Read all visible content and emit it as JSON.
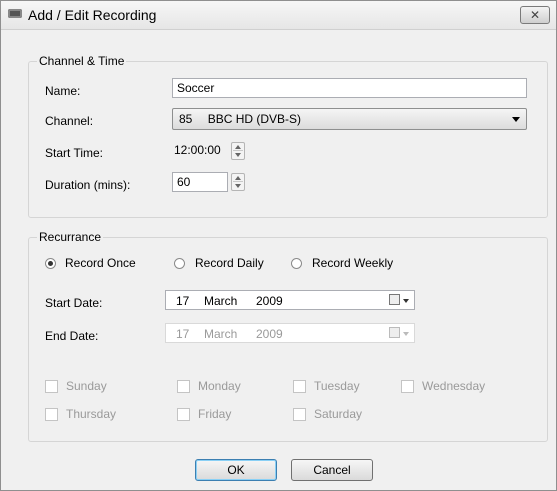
{
  "window": {
    "title": "Add / Edit Recording",
    "close_glyph": "✕"
  },
  "channel_time": {
    "group_label": "Channel & Time",
    "name_label": "Name:",
    "name_value": "Soccer",
    "channel_label": "Channel:",
    "channel_number": "85",
    "channel_name": "BBC HD  (DVB-S)",
    "start_time_label": "Start Time:",
    "start_time_value": "12:00:00",
    "duration_label": "Duration (mins):",
    "duration_value": "60"
  },
  "recurrance": {
    "group_label": "Recurrance",
    "options": [
      "Record Once",
      "Record Daily",
      "Record Weekly"
    ],
    "selected": "Record Once",
    "start_date_label": "Start Date:",
    "start_date": {
      "day": "17",
      "month": "March",
      "year": "2009"
    },
    "end_date_label": "End Date:",
    "end_date": {
      "day": "17",
      "month": "March",
      "year": "2009"
    },
    "days": [
      "Sunday",
      "Monday",
      "Tuesday",
      "Wednesday",
      "Thursday",
      "Friday",
      "Saturday"
    ]
  },
  "buttons": {
    "ok": "OK",
    "cancel": "Cancel"
  }
}
